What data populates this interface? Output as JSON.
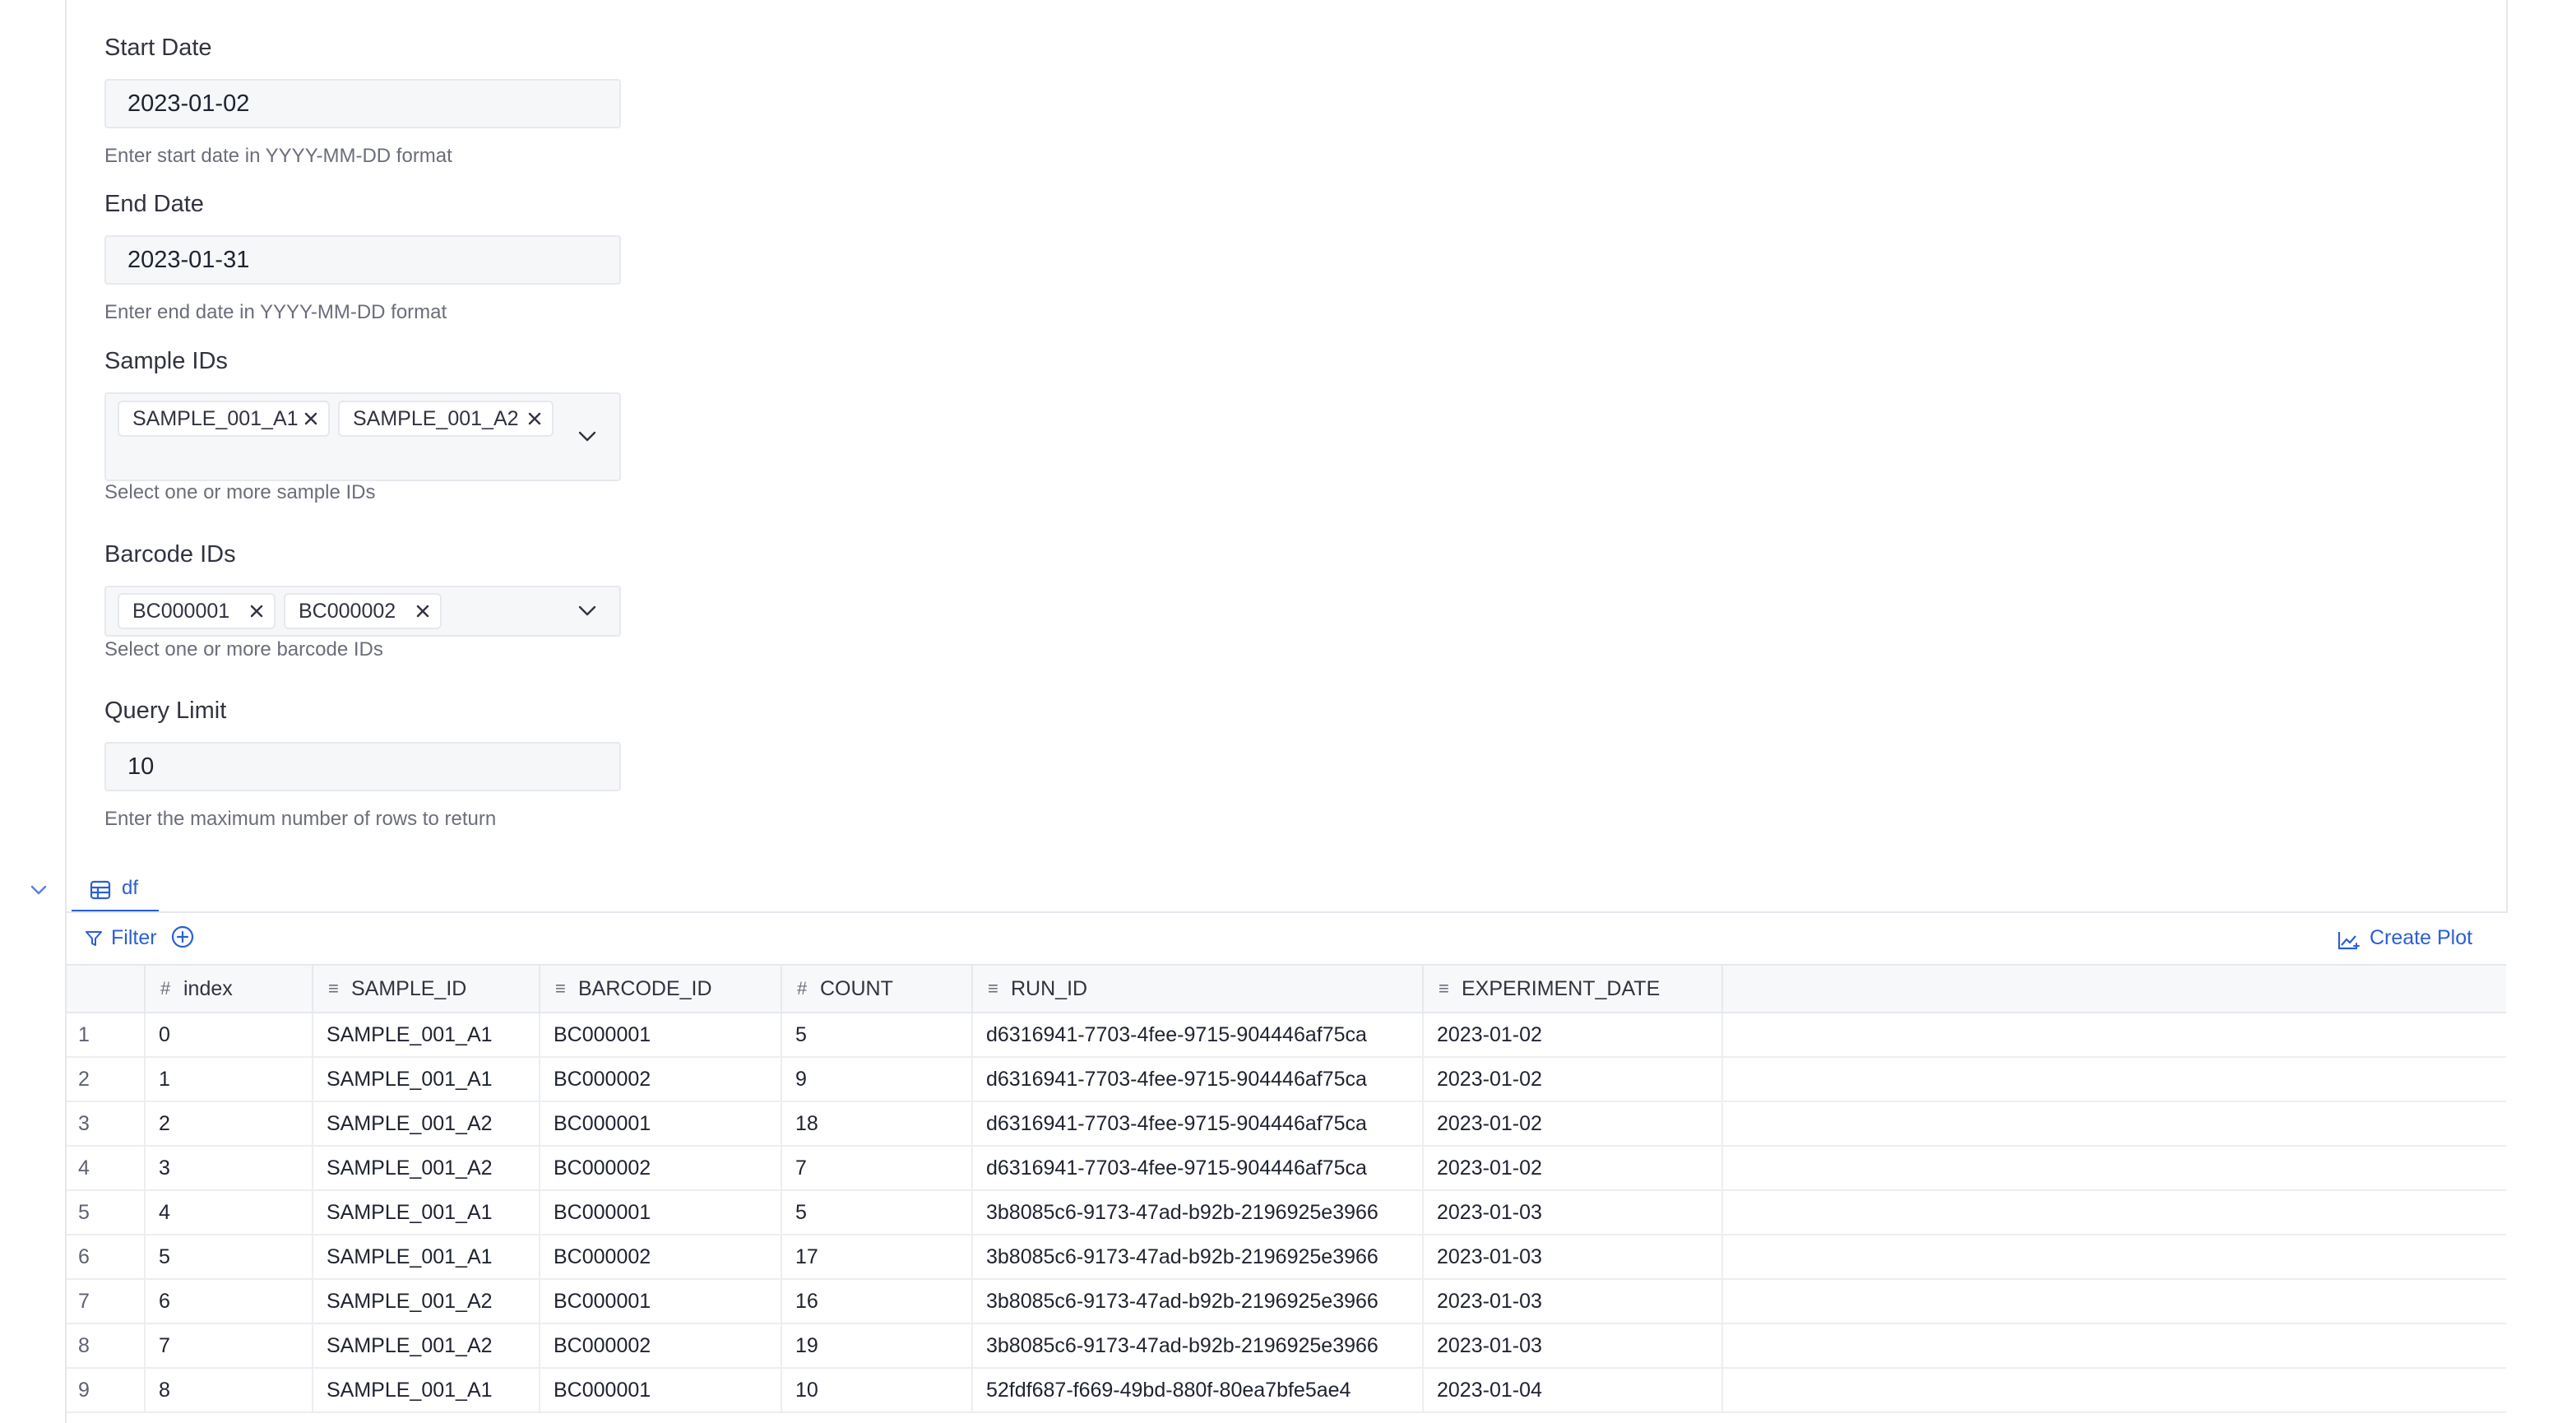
{
  "form": {
    "start_date": {
      "label": "Start Date",
      "value": "2023-01-02",
      "help": "Enter start date in YYYY-MM-DD format"
    },
    "end_date": {
      "label": "End Date",
      "value": "2023-01-31",
      "help": "Enter end date in YYYY-MM-DD format"
    },
    "sample_ids": {
      "label": "Sample IDs",
      "chips": [
        "SAMPLE_001_A1",
        "SAMPLE_001_A2"
      ],
      "help": "Select one or more sample IDs"
    },
    "barcode_ids": {
      "label": "Barcode IDs",
      "chips": [
        "BC000001",
        "BC000002"
      ],
      "help": "Select one or more barcode IDs"
    },
    "query_limit": {
      "label": "Query Limit",
      "value": "10",
      "help": "Enter the maximum number of rows to return"
    }
  },
  "output": {
    "tab_label": "df",
    "filter_label": "Filter",
    "create_plot_label": "Create Plot"
  },
  "table": {
    "columns": [
      {
        "name": "index",
        "type": "number",
        "type_icon": "#"
      },
      {
        "name": "SAMPLE_ID",
        "type": "text",
        "type_icon": "≡"
      },
      {
        "name": "BARCODE_ID",
        "type": "text",
        "type_icon": "≡"
      },
      {
        "name": "COUNT",
        "type": "number",
        "type_icon": "#"
      },
      {
        "name": "RUN_ID",
        "type": "text",
        "type_icon": "≡"
      },
      {
        "name": "EXPERIMENT_DATE",
        "type": "text",
        "type_icon": "≡"
      }
    ],
    "rows": [
      [
        "1",
        "0",
        "SAMPLE_001_A1",
        "BC000001",
        "5",
        "d6316941-7703-4fee-9715-904446af75ca",
        "2023-01-02"
      ],
      [
        "2",
        "1",
        "SAMPLE_001_A1",
        "BC000002",
        "9",
        "d6316941-7703-4fee-9715-904446af75ca",
        "2023-01-02"
      ],
      [
        "3",
        "2",
        "SAMPLE_001_A2",
        "BC000001",
        "18",
        "d6316941-7703-4fee-9715-904446af75ca",
        "2023-01-02"
      ],
      [
        "4",
        "3",
        "SAMPLE_001_A2",
        "BC000002",
        "7",
        "d6316941-7703-4fee-9715-904446af75ca",
        "2023-01-02"
      ],
      [
        "5",
        "4",
        "SAMPLE_001_A1",
        "BC000001",
        "5",
        "3b8085c6-9173-47ad-b92b-2196925e3966",
        "2023-01-03"
      ],
      [
        "6",
        "5",
        "SAMPLE_001_A1",
        "BC000002",
        "17",
        "3b8085c6-9173-47ad-b92b-2196925e3966",
        "2023-01-03"
      ],
      [
        "7",
        "6",
        "SAMPLE_001_A2",
        "BC000001",
        "16",
        "3b8085c6-9173-47ad-b92b-2196925e3966",
        "2023-01-03"
      ],
      [
        "8",
        "7",
        "SAMPLE_001_A2",
        "BC000002",
        "19",
        "3b8085c6-9173-47ad-b92b-2196925e3966",
        "2023-01-03"
      ],
      [
        "9",
        "8",
        "SAMPLE_001_A1",
        "BC000001",
        "10",
        "52fdf687-f669-49bd-880f-80ea7bfe5ae4",
        "2023-01-04"
      ]
    ]
  },
  "colors": {
    "accent": "#2a5fd6",
    "text": "#31333f",
    "help_text": "#6b6e7a",
    "input_bg": "#f6f7f9",
    "border": "#e6e8ee"
  },
  "icons": {
    "chip_remove": "close-icon",
    "dropdown": "chevron-down-icon",
    "tab": "table-icon",
    "filter": "filter-icon",
    "add_filter": "plus-circle-icon",
    "create_plot": "chart-icon",
    "collapse": "chevron-down-icon"
  }
}
